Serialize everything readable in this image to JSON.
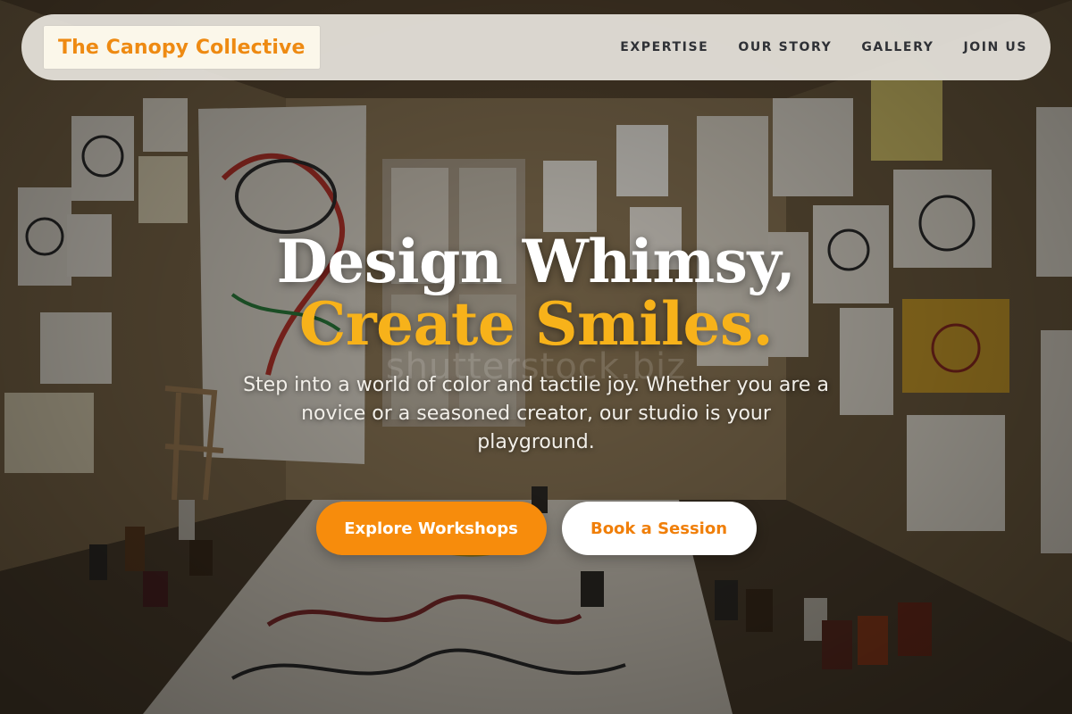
{
  "header": {
    "brand_name": "The Canopy Collective",
    "nav": [
      {
        "label": "EXPERTISE"
      },
      {
        "label": "OUR STORY"
      },
      {
        "label": "GALLERY"
      },
      {
        "label": "JOIN US"
      }
    ]
  },
  "hero": {
    "headline_line_1": "Design Whimsy,",
    "headline_line_2": "Create Smiles.",
    "intro": "Step into a world of color and tactile joy. Whether you are a novice or a seasoned creator, our studio is your playground.",
    "primary_cta": "Explore Workshops",
    "secondary_cta": "Book a Session",
    "watermark": "shutterstock.biz"
  },
  "colors": {
    "accent_orange": "#f78c0c",
    "headline_gold": "#f7b21a",
    "brand_orange": "#ee8a12",
    "header_bg": "#ece9e2",
    "nav_text": "#2f3136"
  },
  "background_image": "art-studio-room-with-childlike-drawings-icon"
}
